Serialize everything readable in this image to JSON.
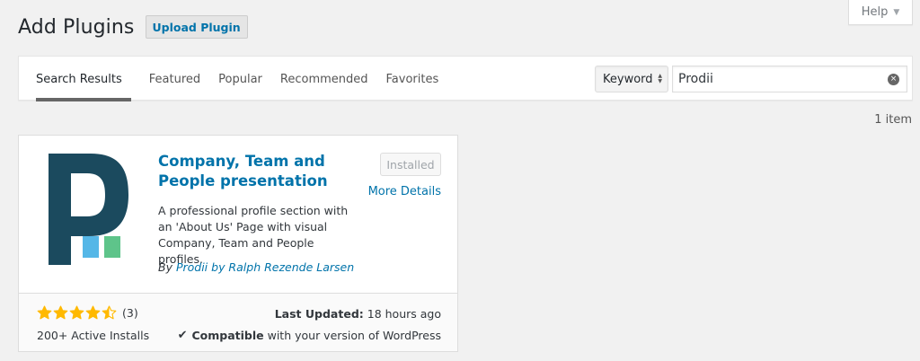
{
  "help": {
    "label": "Help",
    "caret": "▼"
  },
  "header": {
    "title": "Add Plugins",
    "upload_label": "Upload Plugin"
  },
  "filter": {
    "tabs": [
      {
        "label": "Search Results",
        "current": true
      },
      {
        "label": "Featured"
      },
      {
        "label": "Popular"
      },
      {
        "label": "Recommended"
      },
      {
        "label": "Favorites"
      }
    ],
    "search_type": "Keyword",
    "search_value": "Prodii",
    "clear_icon": "×"
  },
  "result": {
    "count_label": "1 item"
  },
  "plugin": {
    "name": "Company, Team and People presentation",
    "installed_label": "Installed",
    "more_details_label": "More Details",
    "description": "A professional profile section with an 'About Us' Page with visual Company, Team and People profiles.",
    "author_prefix": "By ",
    "author": "Prodii by Ralph Rezende Larsen",
    "rating": 4.5,
    "rating_count": "(3)",
    "active_installs": "200+ Active Installs",
    "last_updated_label": "Last Updated:",
    "last_updated_value": " 18 hours ago",
    "compat_check": "✔",
    "compat_label": "Compatible",
    "compat_suffix": " with your version of WordPress",
    "icon_colors": {
      "letter": "#1b4a5e",
      "blue": "#55b7e7",
      "green": "#5ec48a"
    }
  },
  "colors": {
    "link": "#0073aa",
    "star": "#ffb900"
  }
}
